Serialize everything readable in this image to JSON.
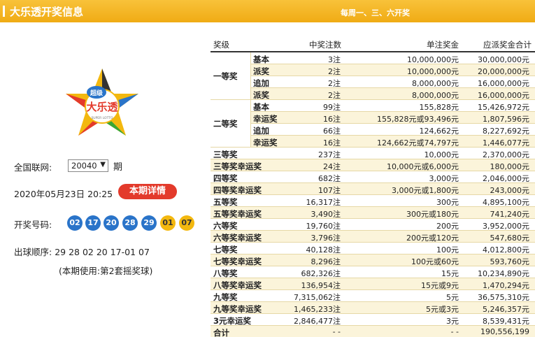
{
  "header": {
    "title": "大乐透开奖信息",
    "schedule": "每周一、三、六开奖"
  },
  "logo": {
    "alt": "超级大乐透"
  },
  "draw_info": {
    "issue_label": "全国联网:",
    "issue_value": "20040",
    "period_label": "期",
    "datetime": "2020年05月23日 20:25",
    "detail_button": "本期详情",
    "numbers_label": "开奖号码:",
    "front_balls": [
      "02",
      "17",
      "20",
      "28",
      "29"
    ],
    "back_balls": [
      "01",
      "07"
    ],
    "order_label": "出球顺序:",
    "order_value": "29 28 02 20 17-01 07",
    "ball_set_note": "(本期使用:第2套摇奖球)"
  },
  "colors": {
    "header": "#f0ab14",
    "blue_ball": "#2a74c9",
    "yellow_ball": "#f3b80f",
    "detail_button": "#e33a2b",
    "row_band": "#fbf4da"
  },
  "table": {
    "headers": {
      "level": "奖级",
      "count": "中奖注数",
      "unit_prize": "单注奖金",
      "total": "应派奖金合计"
    },
    "groups": [
      {
        "name": "一等奖",
        "rows": [
          {
            "sub": "基本",
            "count": "3注",
            "unit": "10,000,000元",
            "total": "30,000,000元"
          },
          {
            "sub": "派奖",
            "count": "2注",
            "unit": "10,000,000元",
            "total": "20,000,000元"
          },
          {
            "sub": "追加",
            "count": "2注",
            "unit": "8,000,000元",
            "total": "16,000,000元"
          },
          {
            "sub": "派奖",
            "count": "2注",
            "unit": "8,000,000元",
            "total": "16,000,000元"
          }
        ]
      },
      {
        "name": "二等奖",
        "rows": [
          {
            "sub": "基本",
            "count": "99注",
            "unit": "155,828元",
            "total": "15,426,972元"
          },
          {
            "sub": "幸运奖",
            "count": "16注",
            "unit": "155,828元或93,496元",
            "total": "1,807,596元"
          },
          {
            "sub": "追加",
            "count": "66注",
            "unit": "124,662元",
            "total": "8,227,692元"
          },
          {
            "sub": "幸运奖",
            "count": "16注",
            "unit": "124,662元或74,797元",
            "total": "1,446,077元"
          }
        ]
      }
    ],
    "rows": [
      {
        "name": "三等奖",
        "count": "237注",
        "unit": "10,000元",
        "total": "2,370,000元"
      },
      {
        "name": "三等奖幸运奖",
        "count": "24注",
        "unit": "10,000元或6,000元",
        "total": "180,000元"
      },
      {
        "name": "四等奖",
        "count": "682注",
        "unit": "3,000元",
        "total": "2,046,000元"
      },
      {
        "name": "四等奖幸运奖",
        "count": "107注",
        "unit": "3,000元或1,800元",
        "total": "243,000元"
      },
      {
        "name": "五等奖",
        "count": "16,317注",
        "unit": "300元",
        "total": "4,895,100元"
      },
      {
        "name": "五等奖幸运奖",
        "count": "3,490注",
        "unit": "300元或180元",
        "total": "741,240元"
      },
      {
        "name": "六等奖",
        "count": "19,760注",
        "unit": "200元",
        "total": "3,952,000元"
      },
      {
        "name": "六等奖幸运奖",
        "count": "3,796注",
        "unit": "200元或120元",
        "total": "547,680元"
      },
      {
        "name": "七等奖",
        "count": "40,128注",
        "unit": "100元",
        "total": "4,012,800元"
      },
      {
        "name": "七等奖幸运奖",
        "count": "8,296注",
        "unit": "100元或60元",
        "total": "593,760元"
      },
      {
        "name": "八等奖",
        "count": "682,326注",
        "unit": "15元",
        "total": "10,234,890元"
      },
      {
        "name": "八等奖幸运奖",
        "count": "136,954注",
        "unit": "15元或9元",
        "total": "1,470,294元"
      },
      {
        "name": "九等奖",
        "count": "7,315,062注",
        "unit": "5元",
        "total": "36,575,310元"
      },
      {
        "name": "九等奖幸运奖",
        "count": "1,465,233注",
        "unit": "5元或3元",
        "total": "5,246,357元"
      },
      {
        "name": "3元幸运奖",
        "count": "2,846,477注",
        "unit": "3元",
        "total": "8,539,431元"
      },
      {
        "name": "合计",
        "count": "- -",
        "unit": "- -",
        "total": "190,556,199"
      }
    ]
  }
}
